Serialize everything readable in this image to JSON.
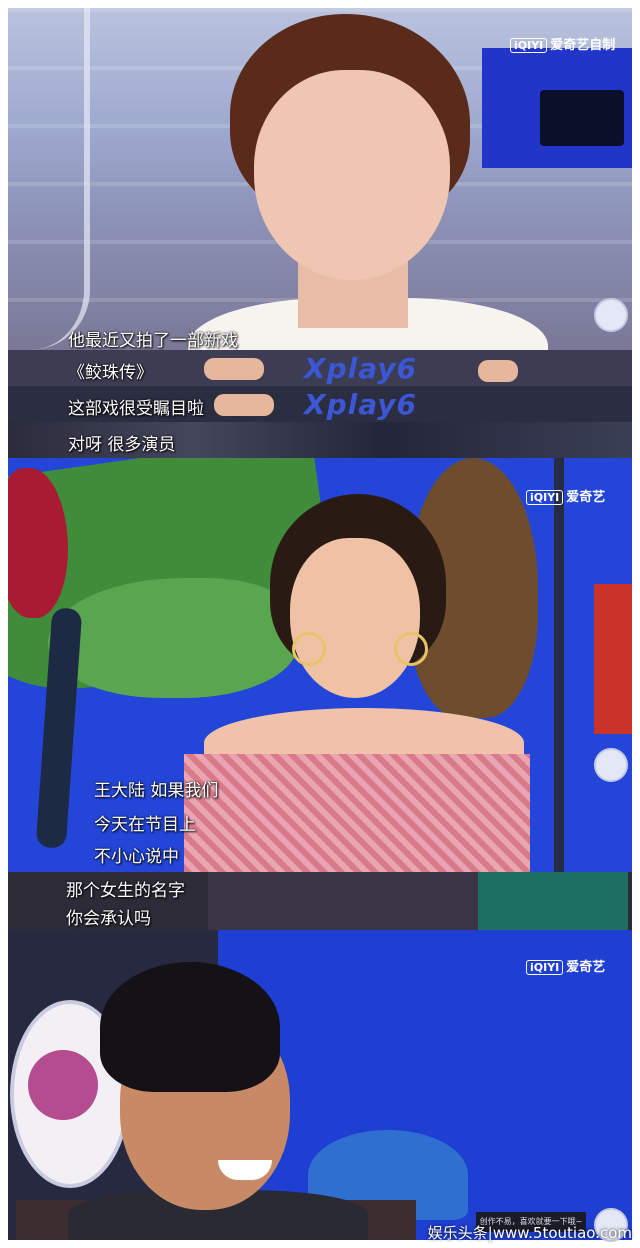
{
  "watermarks": {
    "panel1": {
      "logo_box": "iQIYI",
      "text": "爱奇艺自制"
    },
    "panel2": {
      "logo_box": "iQIYI",
      "text": "爱奇艺"
    },
    "panel3": {
      "logo_box": "iQIYI",
      "text": "爱奇艺"
    }
  },
  "subtitles": {
    "panel1": [
      "他最近又拍了一部新戏",
      "《鲛珠传》",
      "这部戏很受瞩目啦",
      "对呀 很多演员"
    ],
    "strip_logo": "Xplay6",
    "panel2": [
      "王大陆 如果我们",
      "今天在节目上",
      "不小心说中",
      "那个女生的名字",
      "你会承认吗"
    ]
  },
  "ticker_text": "创作不易，喜欢就要一下哦~",
  "footer": {
    "text": "娱乐头条|www.5toutiao.com"
  },
  "colors": {
    "studio_blue": "#2345d8",
    "subtitle": "#ffffff"
  }
}
